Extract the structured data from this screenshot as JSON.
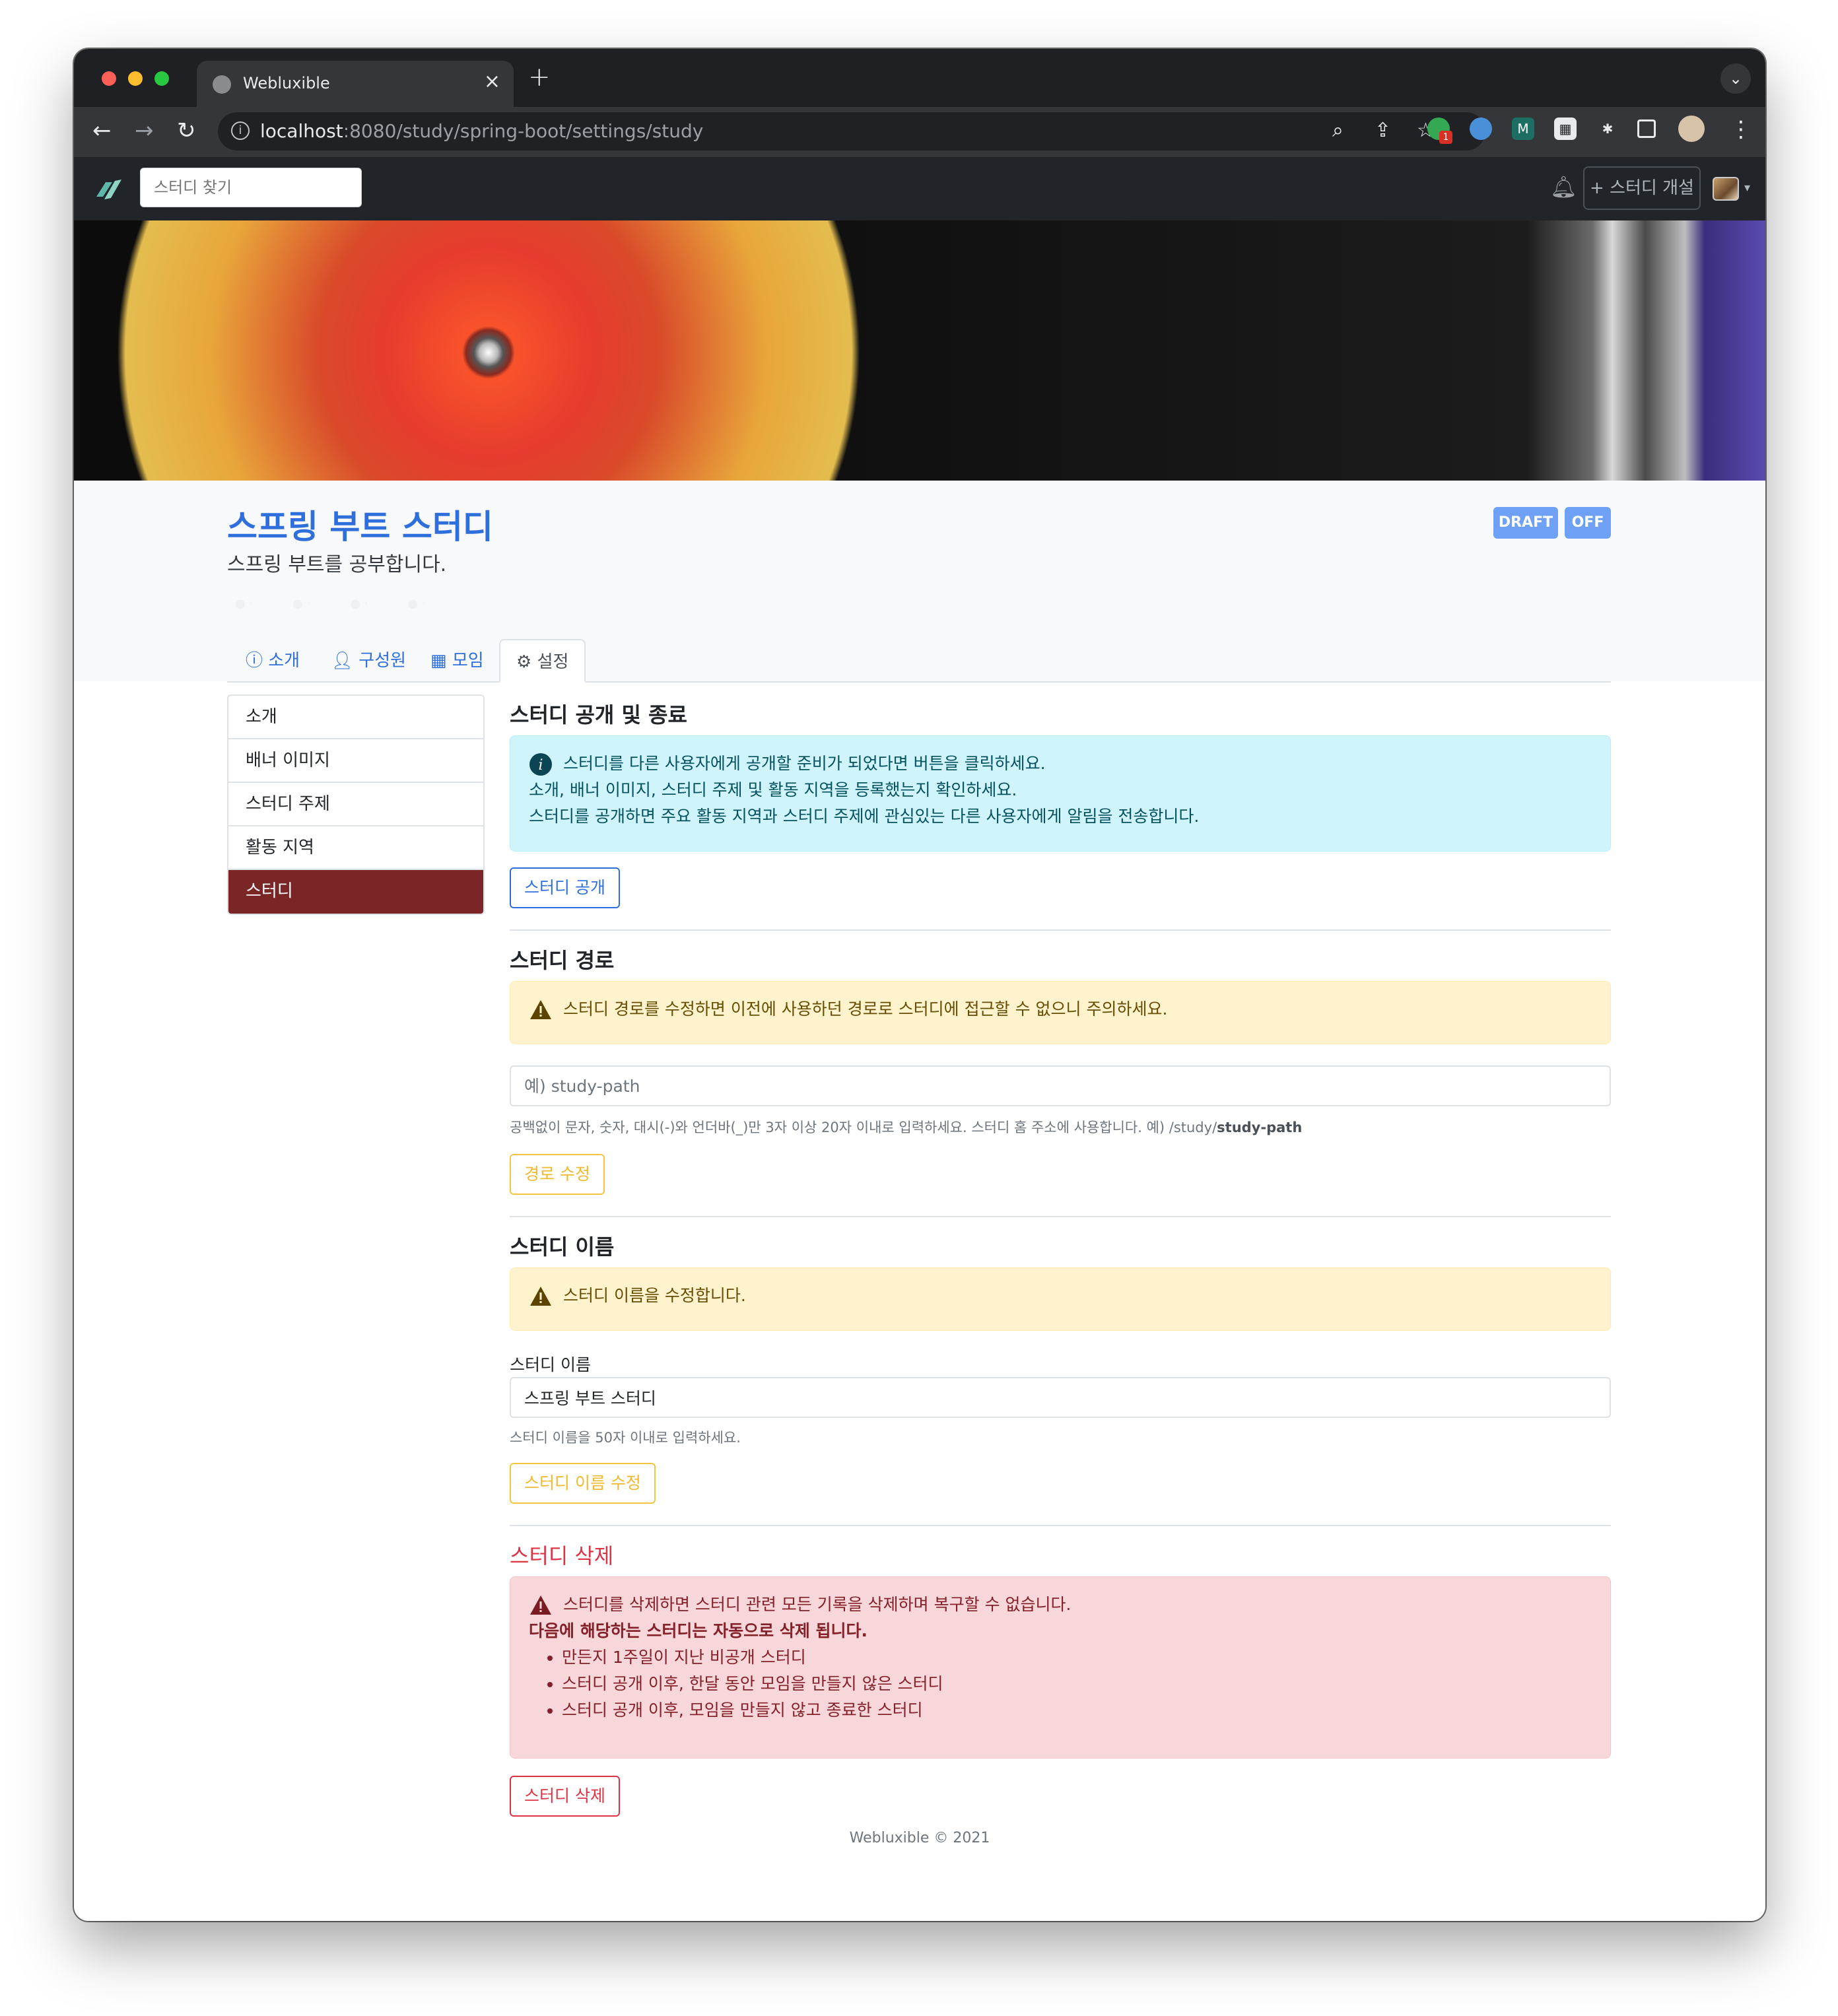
{
  "browser": {
    "tab_title": "Webluxible",
    "close_glyph": "×",
    "new_tab_glyph": "+",
    "tab_menu_glyph": "⌄",
    "url_host": "localhost",
    "url_rest": ":8080/study/spring-boot/settings/study",
    "ext_badge": "1"
  },
  "nav": {
    "search_placeholder": "스터디 찾기",
    "open_study_label": "+ 스터디 개설"
  },
  "study": {
    "title": "스프링 부트 스터디",
    "description": "스프링 부트를 공부합니다.",
    "badge_draft": "DRAFT",
    "badge_off": "OFF"
  },
  "tabs": [
    {
      "icon": "info-icon",
      "label": "소개"
    },
    {
      "icon": "user-icon",
      "label": "구성원"
    },
    {
      "icon": "calendar-icon",
      "label": "모임"
    },
    {
      "icon": "gear-icon",
      "label": "설정"
    }
  ],
  "side_menu": [
    "소개",
    "배너 이미지",
    "스터디 주제",
    "활동 지역",
    "스터디"
  ],
  "publish": {
    "title": "스터디 공개 및 종료",
    "line1": "스터디를 다른 사용자에게 공개할 준비가 되었다면 버튼을 클릭하세요.",
    "line2": "소개, 배너 이미지, 스터디 주제 및 활동 지역을 등록했는지 확인하세요.",
    "line3": "스터디를 공개하면 주요 활동 지역과 스터디 주제에 관심있는 다른 사용자에게 알림을 전송합니다.",
    "button": "스터디 공개"
  },
  "path": {
    "title": "스터디 경로",
    "warning": "스터디 경로를 수정하면 이전에 사용하던 경로로 스터디에 접근할 수 없으니 주의하세요.",
    "placeholder": "예) study-path",
    "help": "공백없이 문자, 숫자, 대시(-)와 언더바(_)만 3자 이상 20자 이내로 입력하세요. 스터디 홈 주소에 사용합니다. 예) /study/",
    "help_bold": "study-path",
    "button": "경로 수정"
  },
  "name": {
    "title": "스터디 이름",
    "warning": "스터디 이름을 수정합니다.",
    "label": "스터디 이름",
    "value": "스프링 부트 스터디",
    "help": "스터디 이름을 50자 이내로 입력하세요.",
    "button": "스터디 이름 수정"
  },
  "delete": {
    "title": "스터디 삭제",
    "warning": "스터디를 삭제하면 스터디 관련 모든 기록을 삭제하며 복구할 수 없습니다.",
    "auto_title": "다음에 해당하는 스터디는 자동으로 삭제 됩니다.",
    "items": [
      "만든지 1주일이 지난 비공개 스터디",
      "스터디 공개 이후, 한달 동안 모임을 만들지 않은 스터디",
      "스터디 공개 이후, 모임을 만들지 않고 종료한 스터디"
    ],
    "button": "스터디 삭제"
  },
  "footer": "Webluxible © 2021",
  "colors": {
    "primary": "#2e6fdc",
    "active_menu": "#7a2626",
    "danger": "#dc3545",
    "warning": "#f0b930"
  }
}
